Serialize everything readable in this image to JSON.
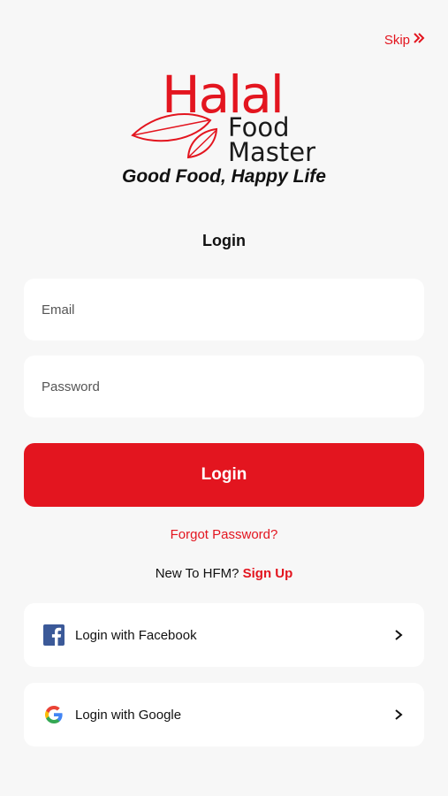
{
  "header": {
    "skip_label": "Skip"
  },
  "logo": {
    "brand_halal": "Halal",
    "brand_food": "Food",
    "brand_master": "Master",
    "tagline": "Good Food, Happy Life"
  },
  "form": {
    "title": "Login",
    "email_placeholder": "Email",
    "password_placeholder": "Password",
    "login_label": "Login",
    "forgot_label": "Forgot Password?",
    "signup_prompt": "New To HFM?",
    "signup_label": "Sign Up"
  },
  "social": {
    "facebook_label": "Login with Facebook",
    "google_label": "Login with Google"
  },
  "colors": {
    "accent": "#e3151f",
    "background": "#f7f7f7",
    "facebook": "#3b5998"
  },
  "icons": {
    "skip": "double-chevron-right-icon",
    "leaf": "leaf-icon",
    "facebook": "facebook-icon",
    "google": "google-icon",
    "chevron": "chevron-right-icon"
  }
}
